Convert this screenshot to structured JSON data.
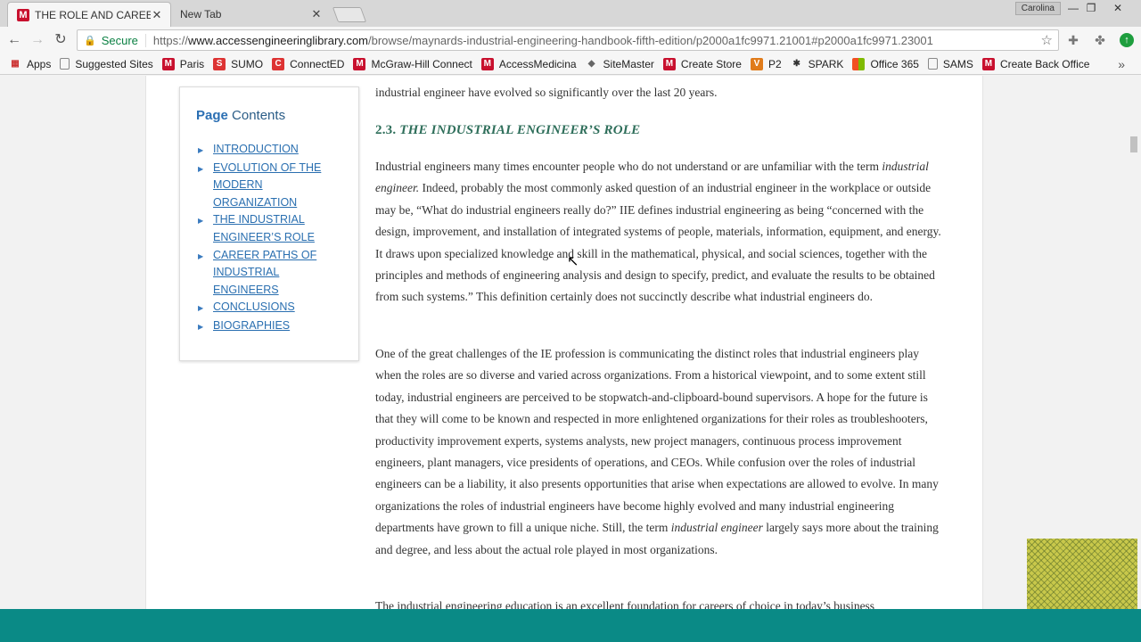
{
  "browser": {
    "tabs": [
      {
        "title": "THE ROLE AND CAREER O",
        "favicon": "M",
        "close": "✕"
      },
      {
        "title": "New Tab",
        "close": "✕"
      }
    ],
    "profile_name": "Carolina",
    "window_controls": {
      "minimize": "—",
      "restore": "❐",
      "close": "✕"
    },
    "secure_label": "Secure",
    "url_scheme": "https://",
    "url_domain": "www.accessengineeringlibrary.com",
    "url_path": "/browse/maynards-industrial-engineering-handbook-fifth-edition/p2000a1fc9971.21001#p2000a1fc9971.23001",
    "bookmarks": [
      {
        "label": "Apps",
        "icon": "apps-grid-icon"
      },
      {
        "label": "Suggested Sites",
        "icon": "page-icon"
      },
      {
        "label": "Paris",
        "icon": "mcgraw-m-icon"
      },
      {
        "label": "SUMO",
        "icon": "sumo-icon"
      },
      {
        "label": "ConnectED",
        "icon": "connected-icon"
      },
      {
        "label": "McGraw-Hill Connect",
        "icon": "mcgraw-m-icon"
      },
      {
        "label": "AccessMedicina",
        "icon": "mcgraw-m-icon"
      },
      {
        "label": "SiteMaster",
        "icon": "sitemaster-icon"
      },
      {
        "label": "Create Store",
        "icon": "mcgraw-m-icon"
      },
      {
        "label": "P2",
        "icon": "v-icon"
      },
      {
        "label": "SPARK",
        "icon": "spark-icon"
      },
      {
        "label": "Office 365",
        "icon": "office-icon"
      },
      {
        "label": "SAMS",
        "icon": "page-icon"
      },
      {
        "label": "Create Back Office",
        "icon": "mcgraw-m-icon"
      }
    ],
    "bookmarks_more": "»"
  },
  "toc": {
    "title_page": "Page",
    "title_rest": " Contents",
    "items": [
      "INTRODUCTION",
      "EVOLUTION OF THE MODERN ORGANIZATION",
      "THE INDUSTRIAL ENGINEER’S ROLE",
      "CAREER PATHS OF INDUSTRIAL ENGINEERS",
      "CONCLUSIONS",
      "BIOGRAPHIES"
    ]
  },
  "article": {
    "partial_line": "industrial engineer have evolved so significantly over the last 20 years.",
    "section_number": "2.3.",
    "section_title": "THE INDUSTRIAL ENGINEER’S ROLE",
    "para1_a": "Industrial engineers many times encounter people who do not understand or are unfamiliar with the term ",
    "para1_em": "industrial engineer.",
    "para1_b": " Indeed, probably the most commonly asked question of an industrial engineer in the workplace or outside may be, “What do industrial engineers really do?” IIE defines industrial engineering as being “concerned with the design, improvement, and installation of integrated systems of people, materials, information, equipment, and energy. It draws upon specialized knowledge and skill in the mathematical, physical, and social sciences, together with the principles and methods of engineering analysis and design to specify, predict, and evaluate the results to be obtained from such systems.” This definition certainly does not succinctly describe what industrial engineers do.",
    "para2_a": "One of the great challenges of the IE profession is communicating the distinct roles that industrial engineers play when the roles are so diverse and varied across organizations. From a historical viewpoint, and to some extent still today, industrial engineers are perceived to be stopwatch-and-clipboard-bound supervisors. A hope for the future is that they will come to be known and respected in more enlightened organizations for their roles as troubleshooters, productivity improvement experts, systems analysts, new project managers, continuous process improvement engineers, plant managers, vice presidents of operations, and CEOs. While confusion over the roles of industrial engineers can be a liability, it also presents opportunities that arise when expectations are allowed to evolve. In many organizations the roles of industrial engineers have become highly evolved and many industrial engineering departments have grown to fill a unique niche. Still, the term ",
    "para2_em": "industrial engineer",
    "para2_b": " largely says more about the training and degree, and less about the actual role played in most organizations.",
    "para3": "The industrial engineering education is an excellent foundation for careers of choice in today’s business"
  },
  "colors": {
    "heading": "#2e6e5a",
    "link": "#2a6fb0",
    "bottom_bar": "#0a8a86",
    "brand_red": "#c8102e"
  }
}
